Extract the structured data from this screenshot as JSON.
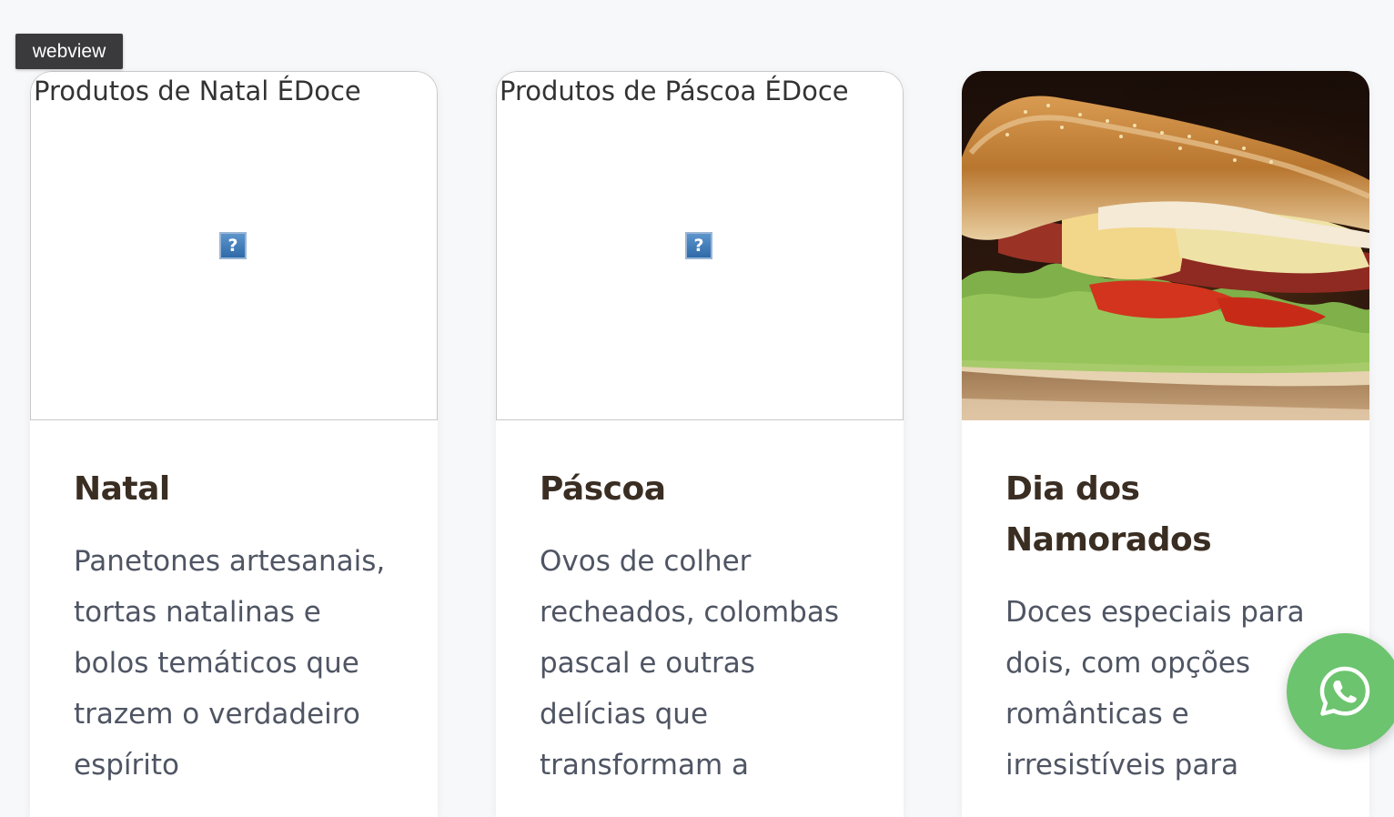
{
  "badge": {
    "label": "webview"
  },
  "cards": [
    {
      "image_alt": "Produtos de Natal ÉDoce",
      "image_broken": true,
      "title": "Natal",
      "description": "Panetones artesanais, tortas natalinas e bolos temáticos que trazem o verdadeiro espírito"
    },
    {
      "image_alt": "Produtos de Páscoa ÉDoce",
      "image_broken": true,
      "title": "Páscoa",
      "description": "Ovos de colher recheados, colombas pascal e outras delícias que transformam a"
    },
    {
      "image_alt": "",
      "image_broken": false,
      "image_subject": "sandwich photo",
      "title": "Dia dos Namorados",
      "description": "Doces especiais para dois, com opções românticas e irresistíveis para"
    }
  ],
  "broken_image_glyph": "?",
  "whatsapp_button": {
    "icon": "whatsapp-icon",
    "color": "#6cc46e"
  },
  "colors": {
    "background": "#f7f8fa",
    "title": "#3a2d22",
    "description": "#4f5563"
  }
}
